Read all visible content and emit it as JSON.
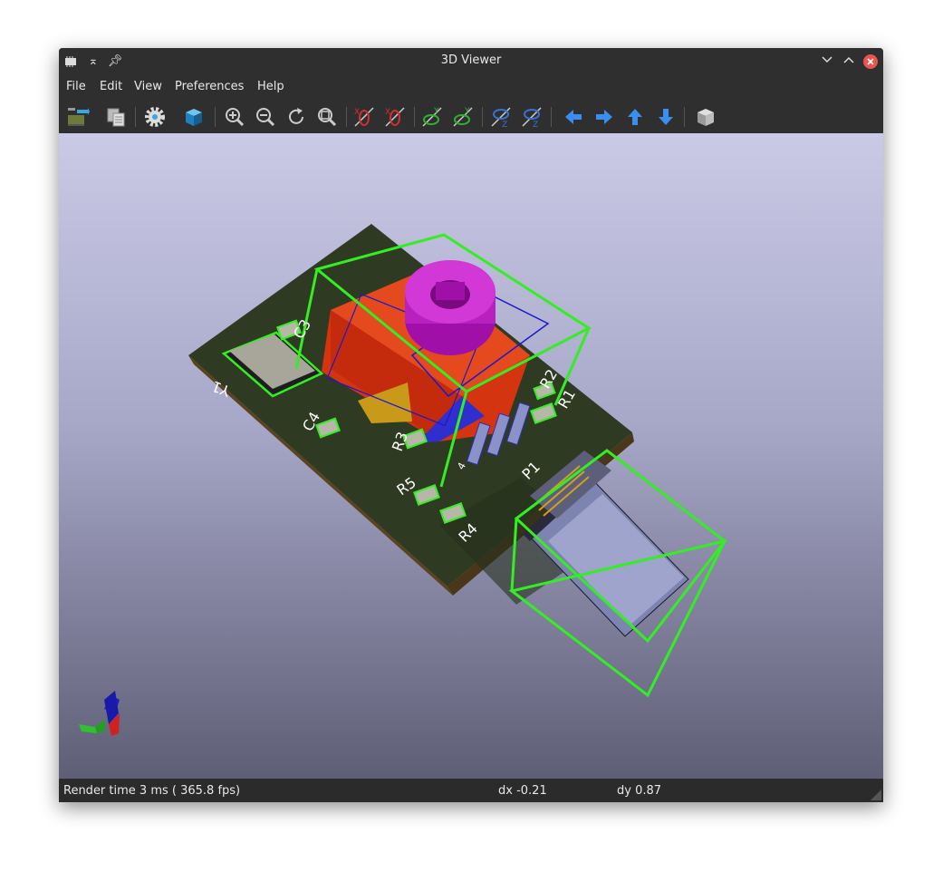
{
  "window": {
    "title": "3D Viewer"
  },
  "menu": {
    "items": [
      "File",
      "Edit",
      "View",
      "Preferences",
      "Help"
    ]
  },
  "toolbar": {
    "icons": [
      "reload-board-icon",
      "copy-image-icon",
      "settings-gear-icon",
      "render-mode-cube-icon",
      "zoom-in-icon",
      "zoom-out-icon",
      "redraw-icon",
      "zoom-fit-icon",
      "rotate-x-cw-icon",
      "rotate-x-ccw-icon",
      "rotate-y-cw-icon",
      "rotate-y-ccw-icon",
      "rotate-z-cw-icon",
      "rotate-z-ccw-icon",
      "pan-left-icon",
      "pan-right-icon",
      "pan-up-icon",
      "pan-down-icon",
      "toggle-ortho-icon"
    ]
  },
  "board": {
    "labels": [
      "Y1",
      "C3",
      "C4",
      "R3",
      "R5",
      "R4",
      "P1",
      "R1",
      "R2",
      "4"
    ]
  },
  "status": {
    "render_time": "Render time 3 ms ( 365.8 fps)",
    "dx": "dx -0.21",
    "dy": "dy 0.87"
  }
}
